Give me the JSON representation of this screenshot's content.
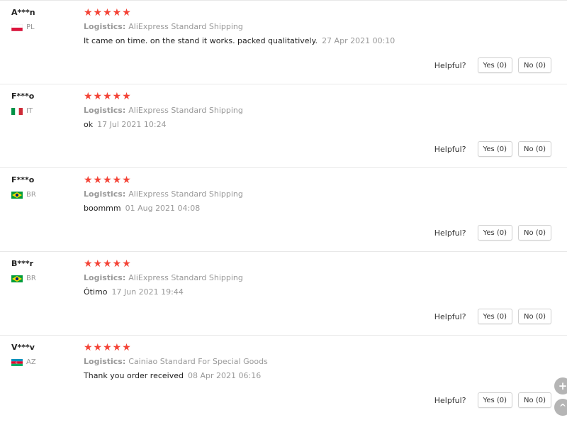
{
  "colors": {
    "star": "#f44336",
    "muted": "#999999",
    "border": "#e8e8e8"
  },
  "reviews": [
    {
      "user": "A***n",
      "country": "PL",
      "flag": "pl-flag-icon",
      "stars": "★★★★★",
      "logistics_label": "Logistics:",
      "logistics_value": "AliExpress Standard Shipping",
      "text": "It came on time. on the stand it works. packed qualitatively.",
      "date": "27 Apr 2021 00:10",
      "helpful_label": "Helpful?",
      "yes": "Yes (0)",
      "no": "No (0)"
    },
    {
      "user": "F***o",
      "country": "IT",
      "flag": "it-flag-icon",
      "stars": "★★★★★",
      "logistics_label": "Logistics:",
      "logistics_value": "AliExpress Standard Shipping",
      "text": "ok",
      "date": "17 Jul 2021 10:24",
      "helpful_label": "Helpful?",
      "yes": "Yes (0)",
      "no": "No (0)"
    },
    {
      "user": "F***o",
      "country": "BR",
      "flag": "br-flag-icon",
      "stars": "★★★★★",
      "logistics_label": "Logistics:",
      "logistics_value": "AliExpress Standard Shipping",
      "text": "boommm",
      "date": "01 Aug 2021 04:08",
      "helpful_label": "Helpful?",
      "yes": "Yes (0)",
      "no": "No (0)"
    },
    {
      "user": "B***r",
      "country": "BR",
      "flag": "br-flag-icon",
      "stars": "★★★★★",
      "logistics_label": "Logistics:",
      "logistics_value": "AliExpress Standard Shipping",
      "text": "Ótimo",
      "date": "17 Jun 2021 19:44",
      "helpful_label": "Helpful?",
      "yes": "Yes (0)",
      "no": "No (0)"
    },
    {
      "user": "V***v",
      "country": "AZ",
      "flag": "az-flag-icon",
      "stars": "★★★★★",
      "logistics_label": "Logistics:",
      "logistics_value": "Cainiao Standard For Special Goods",
      "text": "Thank you order received",
      "date": "08 Apr 2021 06:16",
      "helpful_label": "Helpful?",
      "yes": "Yes (0)",
      "no": "No (0)"
    }
  ],
  "floating": {
    "plus_icon": "plus-icon",
    "up_icon": "chevron-up-icon",
    "plus": "+",
    "up": "^"
  }
}
